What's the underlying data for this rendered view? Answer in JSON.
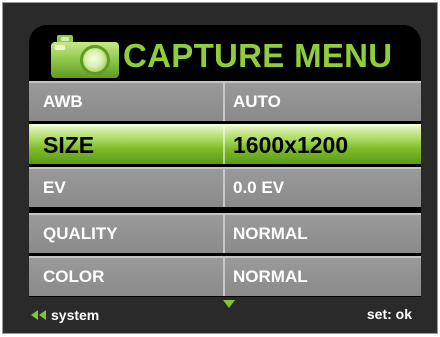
{
  "header": {
    "title": "CAPTURE MENU",
    "icon": "camera-icon"
  },
  "menu": {
    "rows": [
      {
        "label": "AWB",
        "value": "AUTO",
        "selected": false
      },
      {
        "label": "SIZE",
        "value": "1600x1200",
        "selected": true
      },
      {
        "label": "EV",
        "value": "0.0 EV",
        "selected": false
      },
      {
        "label": "QUALITY",
        "value": "NORMAL",
        "selected": false
      },
      {
        "label": "COLOR",
        "value": "NORMAL",
        "selected": false
      }
    ]
  },
  "footer": {
    "left_label": "system",
    "left_icon": "double-left-arrow-icon",
    "center_icon": "down-arrow-icon",
    "right_label": "set: ok"
  },
  "colors": {
    "accent": "#8fce3a",
    "selected_row": "#7ebc2c",
    "row_background": "#929292",
    "panel": "#000000",
    "frame": "#2a2a2a"
  }
}
